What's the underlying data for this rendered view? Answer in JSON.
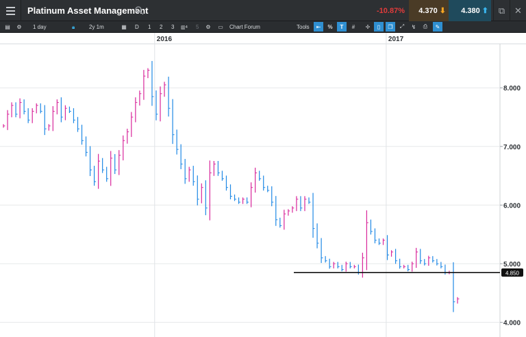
{
  "header": {
    "title": "Platinum Asset Management",
    "change_pct": "-10.87%",
    "sell_price": "4.370",
    "buy_price": "4.380"
  },
  "toolbar": {
    "interval": "1 day",
    "range": "2y 1m",
    "period_d": "D",
    "period_1": "1",
    "period_2": "2",
    "period_3": "3",
    "period_4": "4",
    "period_5": "5",
    "chart_forum": "Chart Forum",
    "tools": "Tools",
    "percent": "%"
  },
  "icons": {
    "menu": "hamburger-icon",
    "search": "search-icon",
    "popout": "popout-icon",
    "close": "close-icon"
  },
  "colors": {
    "up": "#d8259a",
    "down": "#1e88e5",
    "negative": "#e23b3b",
    "accent": "#2f8fd1"
  },
  "chart_data": {
    "type": "line",
    "style": "hlc-bars",
    "x_labels": [
      "2016",
      "2017"
    ],
    "y_ticks": [
      "4.000",
      "5.000",
      "6.000",
      "7.000",
      "8.000"
    ],
    "ylim": [
      3.75,
      8.75
    ],
    "grid": true,
    "level_line": {
      "value": 4.85,
      "label": "4.850"
    },
    "series": [
      {
        "values": [
          7.35,
          7.55,
          7.7,
          7.55,
          7.75,
          7.6,
          7.45,
          7.6,
          7.7,
          7.6,
          7.3,
          7.35,
          7.6,
          7.75,
          7.5,
          7.65,
          7.6,
          7.45,
          7.3,
          7.1,
          6.9,
          6.6,
          6.4,
          6.75,
          6.6,
          6.45,
          6.8,
          6.6,
          6.85,
          7.1,
          7.25,
          7.5,
          7.75,
          7.9,
          8.2,
          8.3,
          7.85,
          7.55,
          7.9,
          8.05,
          7.65,
          7.2,
          6.95,
          6.7,
          6.45,
          6.6,
          6.4,
          6.1,
          6.3,
          5.95,
          6.55,
          6.7,
          6.55,
          6.45,
          6.3,
          6.15,
          6.1,
          6.05,
          6.1,
          6.05,
          6.3,
          6.55,
          6.45,
          6.3,
          6.25,
          6.05,
          5.75,
          5.65,
          5.85,
          5.9,
          5.95,
          6.1,
          5.95,
          6.1,
          6.05,
          5.6,
          5.35,
          5.1,
          5.05,
          4.95,
          5.0,
          4.95,
          4.9,
          5.0,
          4.95,
          4.95,
          4.85,
          5.1,
          5.7,
          5.55,
          5.4,
          5.35,
          5.4,
          5.15,
          5.2,
          5.05,
          4.95,
          4.95,
          4.9,
          5.0,
          5.2,
          5.05,
          5.0,
          5.1,
          5.05,
          5.0,
          4.95,
          4.85,
          4.85,
          4.35,
          4.4
        ]
      }
    ]
  }
}
